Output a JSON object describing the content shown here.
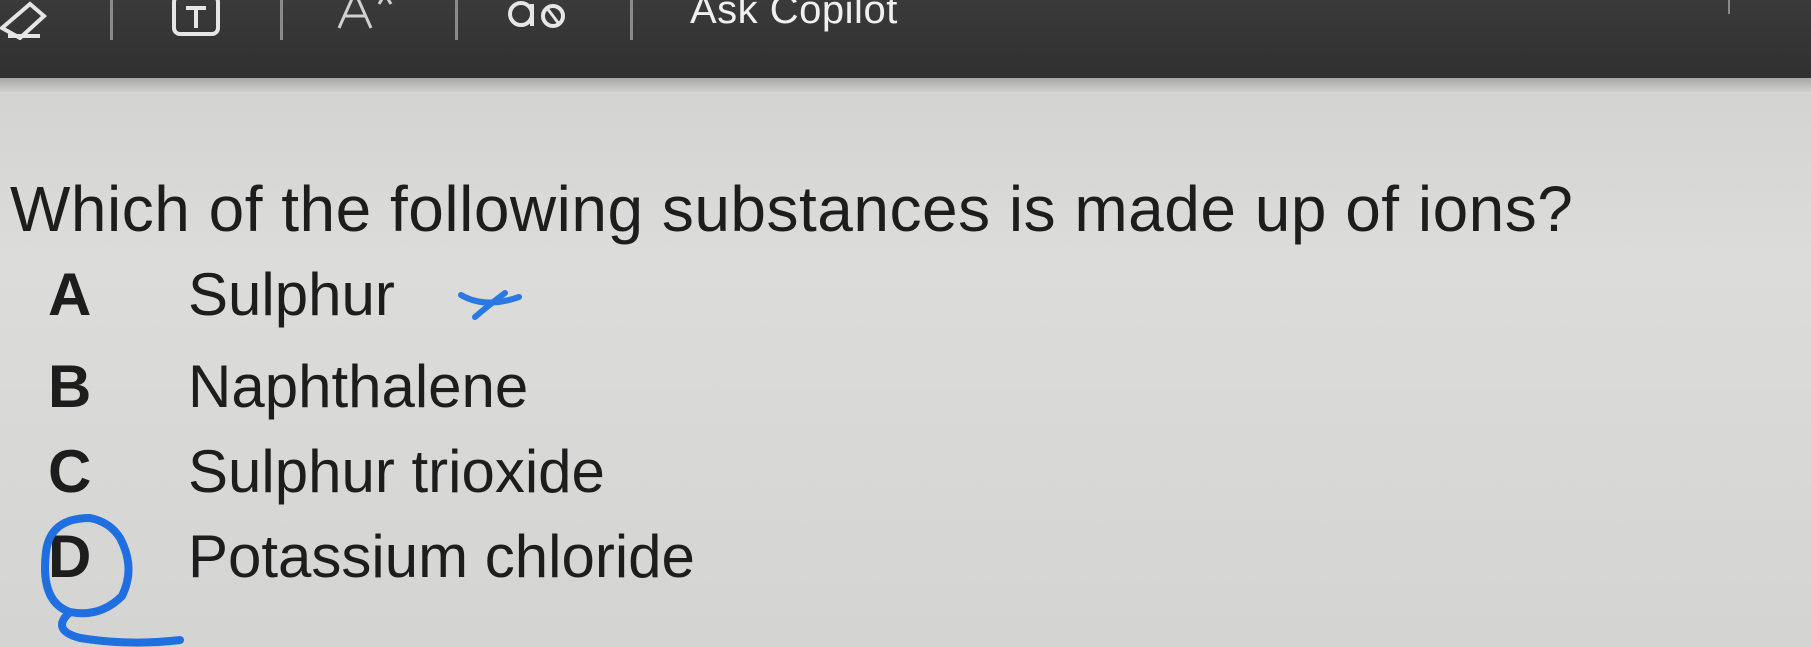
{
  "toolbar": {
    "items": [
      {
        "name": "draw-icon",
        "glyph": ""
      },
      {
        "name": "text-box-icon",
        "glyph": "T"
      },
      {
        "name": "font-size-icon",
        "glyph": "A"
      },
      {
        "name": "read-aloud-icon",
        "glyph": "ab"
      }
    ],
    "copilot_label": "Ask Copilot",
    "background": "#333333"
  },
  "question": {
    "text": "Which of the following substances is made up of ions?",
    "options": [
      {
        "letter": "A",
        "text": "Sulphur"
      },
      {
        "letter": "B",
        "text": "Naphthalene"
      },
      {
        "letter": "C",
        "text": "Sulphur trioxide"
      },
      {
        "letter": "D",
        "text": "Potassium chloride"
      }
    ],
    "selected_option": "D",
    "ink_color": "#1f6fe0"
  }
}
